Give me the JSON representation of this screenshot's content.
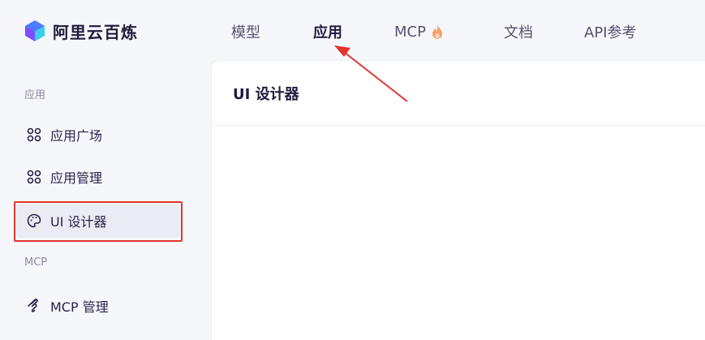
{
  "brand": {
    "name": "阿里云百炼"
  },
  "nav": {
    "tabs": [
      {
        "label": "模型"
      },
      {
        "label": "应用"
      },
      {
        "label": "MCP"
      },
      {
        "label": "文档"
      },
      {
        "label": "API参考"
      }
    ],
    "active": "应用"
  },
  "sidebar": {
    "sections": [
      {
        "title": "应用",
        "items": [
          {
            "label": "应用广场",
            "icon": "grid-icon"
          },
          {
            "label": "应用管理",
            "icon": "grid-icon"
          },
          {
            "label": "UI 设计器",
            "icon": "palette-icon"
          }
        ]
      },
      {
        "title": "MCP",
        "items": [
          {
            "label": "MCP 管理",
            "icon": "mcp-icon"
          }
        ]
      }
    ],
    "active_item": "UI 设计器"
  },
  "main": {
    "title": "UI 设计器"
  },
  "colors": {
    "accent_red": "#e3342f",
    "active_bg": "#ebecf3",
    "text_dark": "#1f1d3d"
  }
}
